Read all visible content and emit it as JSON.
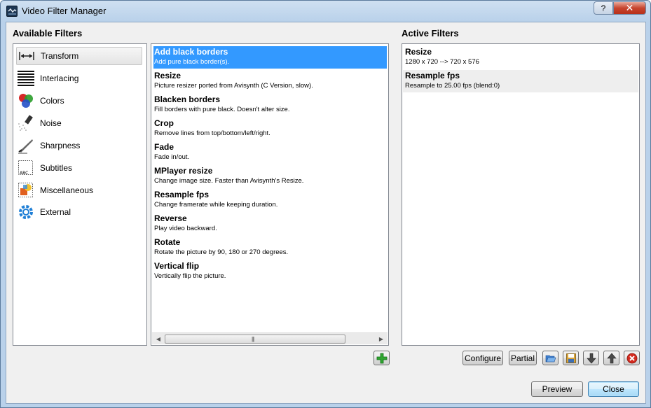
{
  "window": {
    "title": "Video Filter Manager",
    "help_glyph": "?",
    "close_glyph": "✕"
  },
  "available": {
    "heading": "Available Filters",
    "categories": [
      {
        "label": "Transform",
        "icon": "transform-icon"
      },
      {
        "label": "Interlacing",
        "icon": "interlacing-icon"
      },
      {
        "label": "Colors",
        "icon": "colors-icon"
      },
      {
        "label": "Noise",
        "icon": "noise-icon"
      },
      {
        "label": "Sharpness",
        "icon": "sharpness-icon"
      },
      {
        "label": "Subtitles",
        "icon": "subtitles-icon"
      },
      {
        "label": "Miscellaneous",
        "icon": "miscellaneous-icon"
      },
      {
        "label": "External",
        "icon": "external-icon"
      }
    ],
    "selected_category": "Transform",
    "filters": [
      {
        "name": "Add black borders",
        "desc": "Add pure black border(s)."
      },
      {
        "name": "Resize",
        "desc": "Picture resizer ported from Avisynth (C Version, slow)."
      },
      {
        "name": "Blacken borders",
        "desc": "Fill borders with pure black. Doesn't alter size."
      },
      {
        "name": "Crop",
        "desc": "Remove lines from top/bottom/left/right."
      },
      {
        "name": "Fade",
        "desc": "Fade in/out."
      },
      {
        "name": "MPlayer resize",
        "desc": "Change image size. Faster than Avisynth's Resize."
      },
      {
        "name": "Resample fps",
        "desc": "Change framerate while keeping duration."
      },
      {
        "name": "Reverse",
        "desc": "Play video backward."
      },
      {
        "name": "Rotate",
        "desc": "Rotate the picture by 90, 180 or 270 degrees."
      },
      {
        "name": "Vertical flip",
        "desc": "Vertically flip the picture."
      }
    ],
    "selected_filter": "Add black borders",
    "scroll_left": "◀",
    "scroll_right": "▶",
    "scroll_grip": "|||"
  },
  "active": {
    "heading": "Active Filters",
    "items": [
      {
        "name": "Resize",
        "desc": "1280 x 720 --> 720 x 576"
      },
      {
        "name": "Resample fps",
        "desc": "Resample to 25.00 fps (blend:0)"
      }
    ]
  },
  "buttons": {
    "configure": "Configure",
    "partial": "Partial",
    "preview": "Preview",
    "close": "Close"
  },
  "colors": {
    "selection": "#3399ff",
    "title_close": "#c7452e",
    "add_green": "#2fa52f",
    "remove_red": "#d42a1e"
  }
}
